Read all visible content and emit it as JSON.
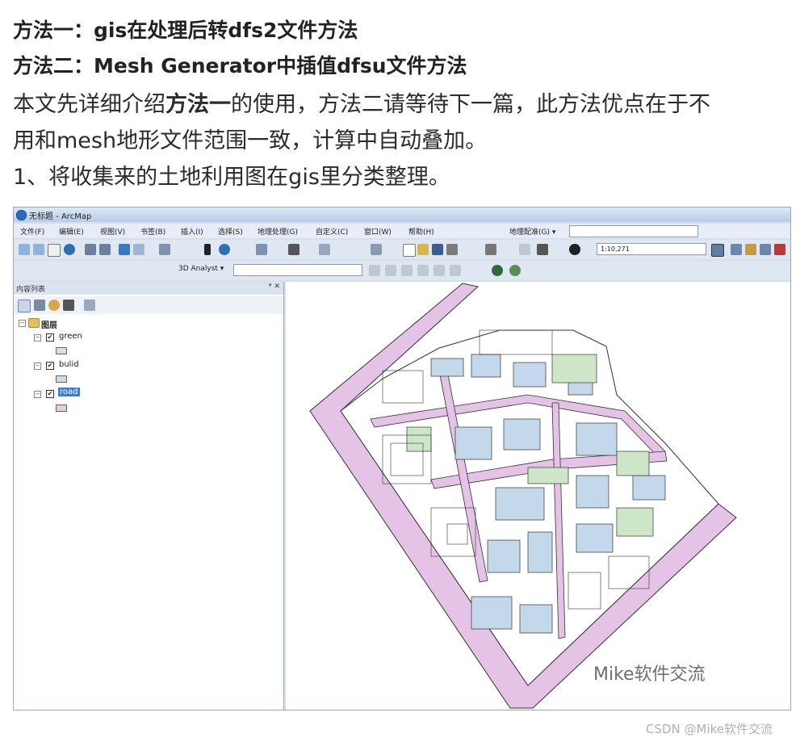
{
  "article": {
    "line1": "方法一：gis在处理后转dfs2文件方法",
    "line2": "方法二：Mesh Generator中插值dfsu文件方法",
    "line3_pre": "本文先详细介绍",
    "line3_bold": "方法一",
    "line3_post": "的使用，方法二请等待下一篇，此方法优点在于不",
    "line4": "用和mesh地形文件范围一致，计算中自动叠加。",
    "line5": "1、将收集来的土地利用图在gis里分类整理。"
  },
  "window": {
    "title": "无标题 - ArcMap",
    "menu": [
      "文件(F)",
      "编辑(E)",
      "视图(V)",
      "书签(B)",
      "插入(I)",
      "选择(S)",
      "地理处理(G)",
      "自定义(C)",
      "窗口(W)",
      "帮助(H)"
    ],
    "georef_label": "地理配准(G) ▾",
    "scale_value": "1:10,271",
    "analyst_label": "3D Analyst ▾"
  },
  "toc": {
    "title": "内容列表",
    "root": "图层",
    "layers": [
      {
        "name": "green",
        "checked": true,
        "selected": false,
        "color": "#cfe8c9"
      },
      {
        "name": "bulid",
        "checked": true,
        "selected": false,
        "color": "#c9dde9"
      },
      {
        "name": "road",
        "checked": true,
        "selected": true,
        "color": "#e8c9e6"
      }
    ]
  },
  "map_colors": {
    "road": "#e4c3e6",
    "building": "#c3d8ea",
    "green": "#cde6c7",
    "line": "#333333"
  },
  "watermark": "Mike软件交流",
  "footer": "CSDN @Mike软件交流"
}
